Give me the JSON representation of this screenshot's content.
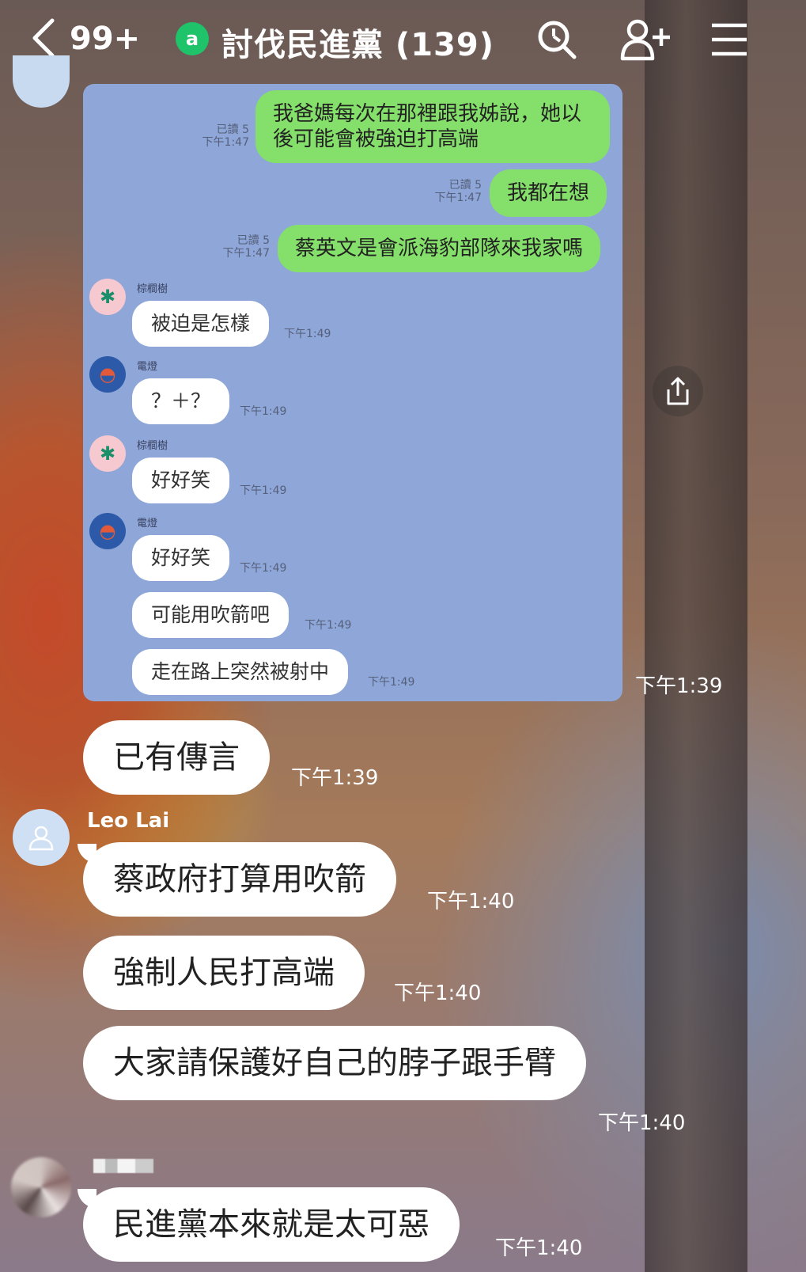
{
  "header": {
    "back_count": "99+",
    "group_badge": "a",
    "title": "討伐民進黨 (139)",
    "icons": [
      "chevron-left-icon",
      "search-icon",
      "add-friend-icon",
      "menu-icon"
    ]
  },
  "image_message": {
    "timestamp": "下午1:39",
    "messages": [
      {
        "type": "sent",
        "text": "我爸媽每次在那裡跟我姊說，她以後可能會被強迫打高端",
        "read": "已讀 5",
        "time": "下午1:47"
      },
      {
        "type": "sent",
        "text": "我都在想",
        "read": "已讀 5",
        "time": "下午1:47"
      },
      {
        "type": "sent",
        "text": "蔡英文是會派海豹部隊來我家嗎",
        "read": "已讀 5",
        "time": "下午1:47"
      },
      {
        "type": "recv",
        "sender": "棕櫚樹",
        "text": "被迫是怎樣",
        "time": "下午1:49"
      },
      {
        "type": "recv",
        "sender": "電燈",
        "text": "？＋？",
        "time": "下午1:49"
      },
      {
        "type": "recv",
        "sender": "棕櫚樹",
        "text": "好好笑",
        "time": "下午1:49"
      },
      {
        "type": "recv",
        "sender": "電燈",
        "text": "好好笑",
        "time": "下午1:49"
      },
      {
        "type": "recv",
        "sender": "",
        "text": "可能用吹箭吧",
        "time": "下午1:49"
      },
      {
        "type": "recv",
        "sender": "",
        "text": "走在路上突然被射中",
        "time": "下午1:49"
      }
    ]
  },
  "messages": [
    {
      "text": "已有傳言",
      "time": "下午1:39"
    },
    {
      "sender": "Leo Lai",
      "text": "蔡政府打算用吹箭",
      "time": "下午1:40"
    },
    {
      "text": "強制人民打高端",
      "time": "下午1:40"
    },
    {
      "text": "大家請保護好自己的脖子跟手臂",
      "time": "下午1:40"
    },
    {
      "text": "民進黨本來就是太可惡",
      "time": "下午1:40"
    }
  ],
  "colors": {
    "sent_bubble": "#85e06b",
    "image_bg": "#8ea6d8",
    "group_badge": "#1ec36a"
  }
}
